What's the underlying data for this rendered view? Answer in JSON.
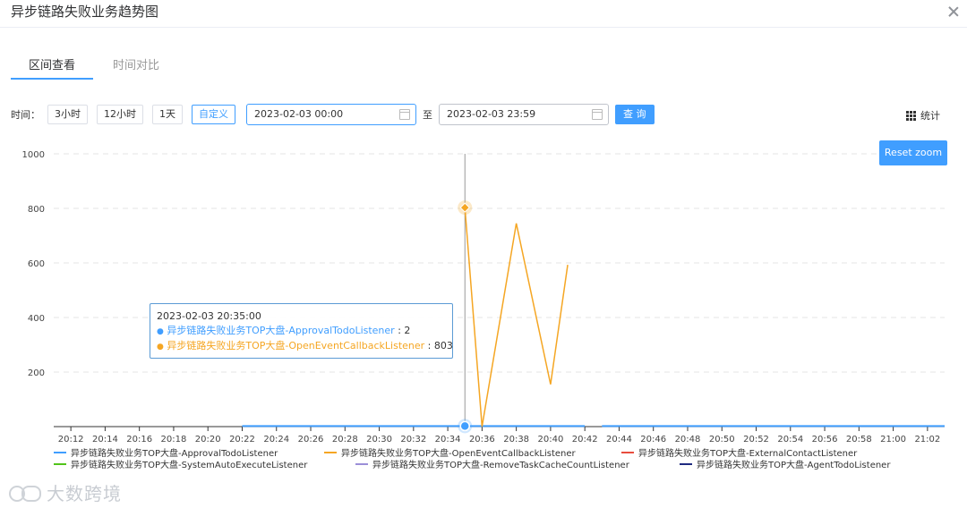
{
  "dialog": {
    "title": "异步链路失败业务趋势图"
  },
  "tabs": [
    {
      "label": "区间查看",
      "active": true
    },
    {
      "label": "时间对比",
      "active": false
    }
  ],
  "toolbar": {
    "time_label": "时间：",
    "ranges": [
      "3小时",
      "12小时",
      "1天",
      "自定义"
    ],
    "active_range": "自定义",
    "start": "2023-02-03 00:00",
    "to_label": "至",
    "end": "2023-02-03 23:59",
    "query_label": "查 询",
    "stats_label": "统计",
    "reset_zoom": "Reset zoom"
  },
  "colors": {
    "accent": "#409eff",
    "series": [
      "#409eff",
      "#f5a623",
      "#e84c3d",
      "#52c41a",
      "#9b8fd8",
      "#1f2a80"
    ]
  },
  "icons": [
    "close-icon",
    "calendar-icon",
    "grid-icon"
  ],
  "chart_data": {
    "type": "line",
    "ylim": [
      0,
      1000
    ],
    "yticks": [
      200,
      400,
      600,
      800,
      1000
    ],
    "xticks": [
      "20:12",
      "20:14",
      "20:16",
      "20:18",
      "20:20",
      "20:22",
      "20:24",
      "20:26",
      "20:28",
      "20:30",
      "20:32",
      "20:34",
      "20:36",
      "20:38",
      "20:40",
      "20:42",
      "20:44",
      "20:46",
      "20:48",
      "20:50",
      "20:52",
      "20:54",
      "20:56",
      "20:58",
      "21:00",
      "21:02"
    ],
    "xrange_minutes": [
      "20:11",
      "21:03"
    ],
    "series": [
      {
        "name": "异步链路失败业务TOP大盘-ApprovalTodoListener",
        "points": [
          [
            "20:22",
            2
          ],
          [
            "20:35",
            2
          ],
          [
            "20:36",
            2
          ],
          [
            "20:37",
            2
          ],
          [
            "20:38",
            2
          ],
          [
            "20:39",
            2
          ],
          [
            "20:40",
            2
          ],
          [
            "20:41",
            2
          ],
          [
            "20:42",
            2
          ],
          [
            "null",
            null
          ],
          [
            "20:43",
            2
          ],
          [
            "21:03",
            2
          ]
        ]
      },
      {
        "name": "异步链路失败业务TOP大盘-OpenEventCallbackListener",
        "points": [
          [
            "20:35",
            803
          ],
          [
            "20:36",
            0
          ],
          [
            "20:38",
            745
          ],
          [
            "20:40",
            155
          ],
          [
            "20:41",
            593
          ]
        ]
      },
      {
        "name": "异步链路失败业务TOP大盘-ExternalContactListener",
        "points": []
      },
      {
        "name": "异步链路失败业务TOP大盘-SystemAutoExecuteListener",
        "points": []
      },
      {
        "name": "异步链路失败业务TOP大盘-RemoveTaskCacheCountListener",
        "points": []
      },
      {
        "name": "异步链路失败业务TOP大盘-AgentTodoListener",
        "points": []
      }
    ],
    "tooltip": {
      "time": "2023-02-03 20:35:00",
      "rows": [
        {
          "series": "异步链路失败业务TOP大盘-ApprovalTodoListener",
          "value": "2"
        },
        {
          "series": "异步链路失败业务TOP大盘-OpenEventCallbackListener",
          "value": "803"
        }
      ]
    }
  },
  "watermark": {
    "text": "大数跨境"
  }
}
